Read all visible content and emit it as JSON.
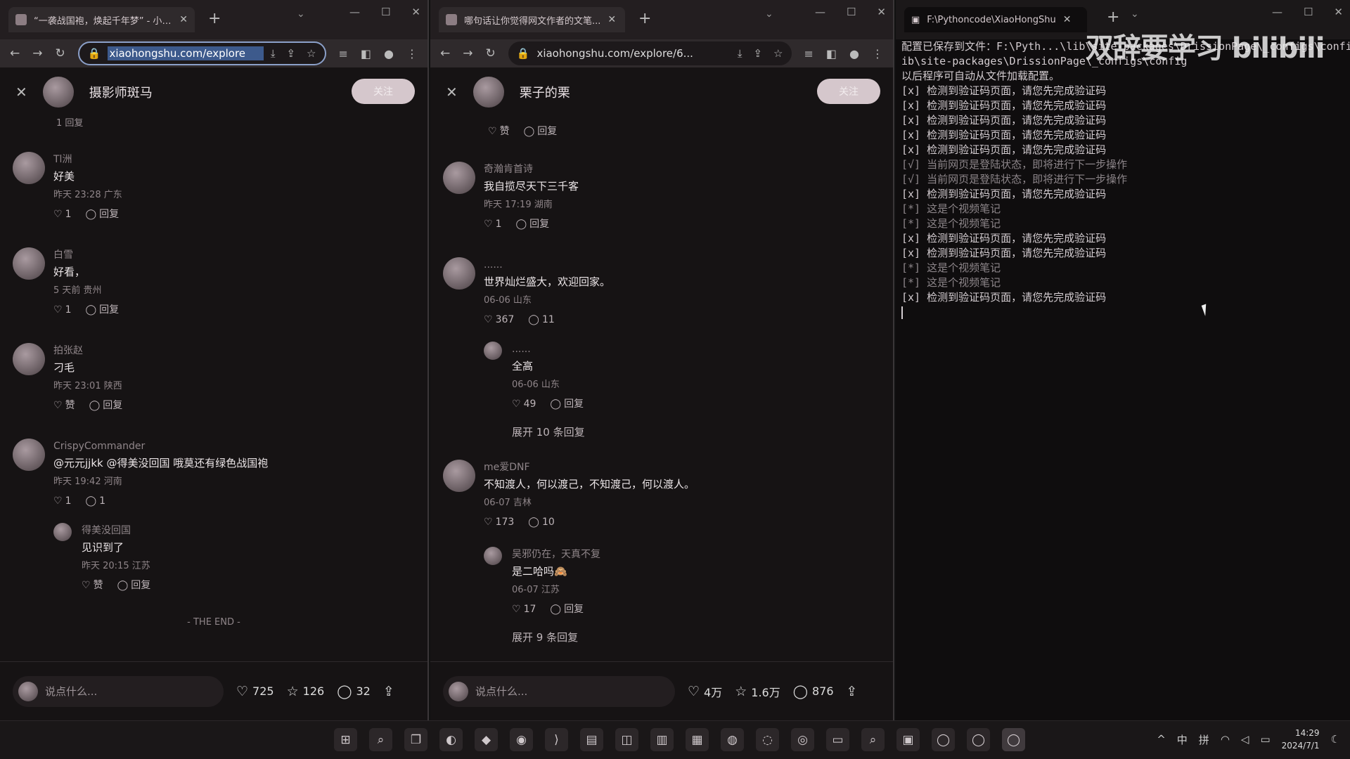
{
  "left_browser": {
    "tab_title": "“一袭战国袍，焕起千年梦” - 小红书",
    "url": "xiaohongshu.com/explore",
    "author": "摄影师斑马",
    "follow_label": "关注",
    "partial_actions": "1    回复",
    "comments": [
      {
        "name": "Tl洲",
        "text": "好美",
        "meta": "昨天 23:28 广东",
        "likes": "1",
        "reply": "回复"
      },
      {
        "name": "白雪",
        "text": "好看，",
        "meta": "5 天前 贵州",
        "likes": "1",
        "reply": "回复"
      },
      {
        "name": "拍张赵",
        "text": "刁毛",
        "meta": "昨天 23:01 陕西",
        "likes": "赞",
        "reply": "回复"
      },
      {
        "name": "CrispyCommander",
        "text": "@元元jjkk @得美没回国 哦莫还有绿色战国袍",
        "meta": "昨天 19:42 河南",
        "likes": "1",
        "reply": "1"
      }
    ],
    "sub_reply": {
      "name": "得美没回国",
      "text": "见识到了",
      "meta": "昨天 20:15 江苏",
      "likes": "赞",
      "reply": "回复"
    },
    "the_end": "- THE END -",
    "input_placeholder": "说点什么...",
    "stats": {
      "likes": "725",
      "stars": "126",
      "comments": "32"
    }
  },
  "mid_browser": {
    "tab_title": "哪句话让你觉得网文作者的文笔...",
    "url": "xiaohongshu.com/explore/6...",
    "author": "栗子的栗",
    "follow_label": "关注",
    "top_actions": {
      "likes": "赞",
      "reply": "回复"
    },
    "comments": [
      {
        "name": "奇瀚肯首诗",
        "text": "我自揽尽天下三千客",
        "meta": "昨天 17:19 湖南",
        "likes": "1",
        "reply": "回复"
      },
      {
        "name": "......",
        "text": "世界灿烂盛大，欢迎回家。",
        "meta": "06-06 山东",
        "likes": "367",
        "reply": "11"
      },
      {
        "name": "me爱DNF",
        "text": "不知渡人，何以渡己，不知渡己，何以渡人。",
        "meta": "06-07 吉林",
        "likes": "173",
        "reply": "10"
      }
    ],
    "sub_replies": [
      {
        "name": "......",
        "text": "全高",
        "meta": "06-06 山东",
        "likes": "49",
        "reply": "回复"
      },
      {
        "name": "吴邪仍在，天真不复",
        "text": "是二哈吗🙈",
        "meta": "06-07 江苏",
        "likes": "17",
        "reply": "回复"
      }
    ],
    "expand_1": "展开 10 条回复",
    "expand_2": "展开 9 条回复",
    "input_placeholder": "说点什么...",
    "stats": {
      "likes": "4万",
      "stars": "1.6万",
      "comments": "876"
    }
  },
  "terminal": {
    "tab_title": "F:\\Pythoncode\\XiaoHongShu",
    "watermark": "双辞要学习 bilibili",
    "lines": [
      {
        "text": "配置已保存到文件：F:\\Pyth...\\lib\\site-packages\\DrissionPage\\_configs\\configs.ini",
        "dim": false
      },
      {
        "text": "ib\\site-packages\\DrissionPage\\_configs\\config",
        "dim": false
      },
      {
        "text": "以后程序可自动从文件加载配置。",
        "dim": false
      },
      {
        "text": "[x] 检测到验证码页面，请您先完成验证码",
        "dim": false
      },
      {
        "text": "[x] 检测到验证码页面，请您先完成验证码",
        "dim": false
      },
      {
        "text": "[x] 检测到验证码页面，请您先完成验证码",
        "dim": false
      },
      {
        "text": "[x] 检测到验证码页面，请您先完成验证码",
        "dim": false
      },
      {
        "text": "[x] 检测到验证码页面，请您先完成验证码",
        "dim": false
      },
      {
        "text": "[√] 当前网页是登陆状态，即将进行下一步操作",
        "dim": true
      },
      {
        "text": "[√] 当前网页是登陆状态，即将进行下一步操作",
        "dim": true
      },
      {
        "text": "[x] 检测到验证码页面，请您先完成验证码",
        "dim": false
      },
      {
        "text": "[*] 这是个视频笔记",
        "dim": true
      },
      {
        "text": "[*] 这是个视频笔记",
        "dim": true
      },
      {
        "text": "[x] 检测到验证码页面，请您先完成验证码",
        "dim": false
      },
      {
        "text": "[x] 检测到验证码页面，请您先完成验证码",
        "dim": false
      },
      {
        "text": "[*] 这是个视频笔记",
        "dim": true
      },
      {
        "text": "[*] 这是个视频笔记",
        "dim": true
      },
      {
        "text": "[x] 检测到验证码页面，请您先完成验证码",
        "dim": false
      }
    ]
  },
  "taskbar": {
    "ime_1": "中",
    "ime_2": "拼",
    "time": "14:29",
    "date": "2024/7/1"
  }
}
